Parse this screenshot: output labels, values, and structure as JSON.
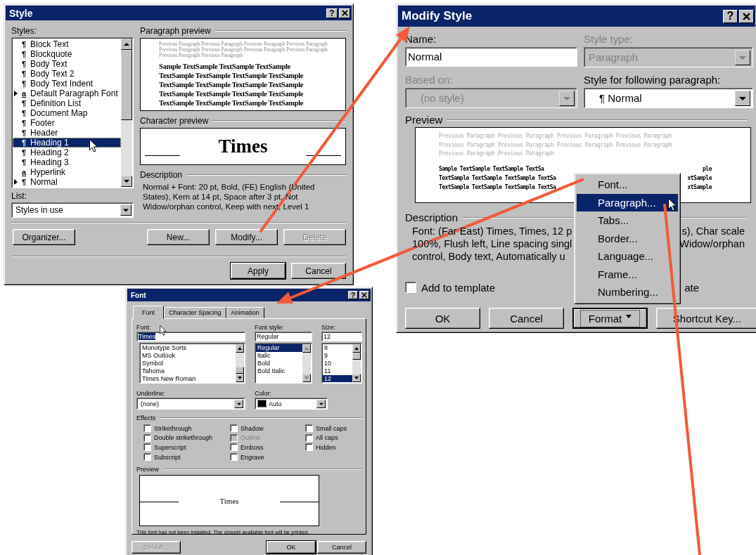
{
  "style_dialog": {
    "title": "Style",
    "help_button": "?",
    "styles_label": "Styles:",
    "styles": [
      {
        "symbol": "¶",
        "kind": "paragraph",
        "label": "Block Text",
        "has_arrow": false,
        "selected": false
      },
      {
        "symbol": "¶",
        "kind": "paragraph",
        "label": "Blockquote",
        "has_arrow": false,
        "selected": false
      },
      {
        "symbol": "¶",
        "kind": "paragraph",
        "label": "Body Text",
        "has_arrow": false,
        "selected": false
      },
      {
        "symbol": "¶",
        "kind": "paragraph",
        "label": "Body Text 2",
        "has_arrow": false,
        "selected": false
      },
      {
        "symbol": "¶",
        "kind": "paragraph",
        "label": "Body Text Indent",
        "has_arrow": false,
        "selected": false
      },
      {
        "symbol": "a",
        "kind": "character",
        "label": "Default Paragraph Font",
        "has_arrow": true,
        "selected": false
      },
      {
        "symbol": "¶",
        "kind": "paragraph",
        "label": "Definition List",
        "has_arrow": false,
        "selected": false
      },
      {
        "symbol": "¶",
        "kind": "paragraph",
        "label": "Document Map",
        "has_arrow": false,
        "selected": false
      },
      {
        "symbol": "¶",
        "kind": "paragraph",
        "label": "Footer",
        "has_arrow": false,
        "selected": false
      },
      {
        "symbol": "¶",
        "kind": "paragraph",
        "label": "Header",
        "has_arrow": false,
        "selected": false
      },
      {
        "symbol": "¶",
        "kind": "paragraph",
        "label": "Heading 1",
        "has_arrow": false,
        "selected": true
      },
      {
        "symbol": "¶",
        "kind": "paragraph",
        "label": "Heading 2",
        "has_arrow": false,
        "selected": false
      },
      {
        "symbol": "¶",
        "kind": "paragraph",
        "label": "Heading 3",
        "has_arrow": false,
        "selected": false
      },
      {
        "symbol": "a",
        "kind": "character",
        "label": "Hyperlink",
        "has_arrow": false,
        "selected": false
      },
      {
        "symbol": "¶",
        "kind": "paragraph",
        "label": "Normal",
        "has_arrow": true,
        "selected": false
      }
    ],
    "list_label": "List:",
    "list_value": "Styles in use",
    "paragraph_preview": {
      "label": "Paragraph preview",
      "previous_lines": [
        "Previous Paragraph Previous Paragraph Previous Paragraph Previous Paragraph",
        "Previous Paragraph Previous Paragraph Previous Paragraph Previous Paragraph",
        "Previous Paragraph Previous Paragraph"
      ],
      "sample_lines": [
        "Sample TextSample TextSample TextSample",
        "TextSample TextSample TextSample TextSample",
        "TextSample TextSample TextSample TextSample",
        "TextSample TextSample TextSample TextSample",
        "TextSample TextSample TextSample TextSample"
      ]
    },
    "character_preview": {
      "label": "Character preview",
      "text": "Times"
    },
    "description": {
      "label": "Description",
      "text": "Normal + Font: 20 pt, Bold, (FE) English (United States), Kern at 14 pt, Space  after 3 pt, Not Widow/orphan control, Keep with next, Level 1"
    },
    "manage_buttons": [
      {
        "label": "Organizer...",
        "disabled": false,
        "default": false
      },
      {
        "label": "New...",
        "disabled": false,
        "default": false
      },
      {
        "label": "Modify...",
        "disabled": false,
        "default": false
      },
      {
        "label": "Delete",
        "disabled": true,
        "default": false
      }
    ],
    "action_buttons": [
      {
        "label": "Apply",
        "disabled": false,
        "default": true
      },
      {
        "label": "Cancel",
        "disabled": false,
        "default": false
      }
    ]
  },
  "modify_style_dialog": {
    "title": "Modify Style",
    "help_button": "?",
    "name": {
      "label": "Name:",
      "value": "Normal"
    },
    "style_type": {
      "label": "Style type:",
      "value": "Paragraph",
      "disabled": true
    },
    "based_on": {
      "label": "Based on:",
      "value": "(no style)",
      "disabled": true
    },
    "following": {
      "label": "Style for following paragraph:",
      "value": "¶ Normal",
      "disabled": false
    },
    "preview": {
      "label": "Preview",
      "previous_lines": [
        "Previous Paragraph Previous Paragraph Previous Paragraph Previous Paragraph",
        "Previous Paragraph Previous Paragraph Previous Paragraph Previous Paragraph",
        "Previous Paragraph Previous Paragraph"
      ],
      "sample_lines": [
        {
          "left": "Sample TextSample TextSample TextSa",
          "right": "ple"
        },
        {
          "left": "TextSample TextSample TextSample TextSa",
          "right": "xtSample"
        },
        {
          "left": "TextSample TextSample TextSample TextSa",
          "right": "xtSample"
        }
      ]
    },
    "description": {
      "label": "Description",
      "lines": [
        {
          "left": "Font: (Far East) Times, Times, 12 p",
          "right": "s), Char scale"
        },
        {
          "left": "100%, Flush left, Line spacing singl",
          "right": "Widow/orphan"
        },
        {
          "left": "control, Body text, Automatically u"
        }
      ]
    },
    "add_to_template": {
      "label": "Add to template",
      "checked": false
    },
    "hidden_option_fragment": "ate",
    "buttons": [
      {
        "label": "OK",
        "kind": "push",
        "focused": false
      },
      {
        "label": "Cancel",
        "kind": "push",
        "focused": false
      },
      {
        "label": "Format",
        "kind": "menu",
        "focused": true
      },
      {
        "label": "Shortcut Key...",
        "kind": "push",
        "focused": false
      }
    ],
    "format_menu": [
      {
        "label": "Font...",
        "selected": false
      },
      {
        "label": "Paragraph...",
        "selected": true
      },
      {
        "label": "Tabs...",
        "selected": false
      },
      {
        "label": "Border...",
        "selected": false
      },
      {
        "label": "Language...",
        "selected": false
      },
      {
        "label": "Frame...",
        "selected": false
      },
      {
        "label": "Numbering...",
        "selected": false
      }
    ]
  },
  "font_dialog": {
    "title": "Font",
    "help_button": "?",
    "tabs": [
      {
        "label": "Font",
        "selected": true
      },
      {
        "label": "Character Spacing",
        "selected": false
      },
      {
        "label": "Animation",
        "selected": false
      }
    ],
    "font": {
      "label": "Font:",
      "value": "Times",
      "value_highlighted": true,
      "options": [
        {
          "label": "Monotype Sorts",
          "selected": false
        },
        {
          "label": "MS Outlook",
          "selected": false
        },
        {
          "label": "Symbol",
          "selected": false
        },
        {
          "label": "Tahoma",
          "selected": false
        },
        {
          "label": "Times New Roman",
          "selected": false
        }
      ]
    },
    "font_style": {
      "label": "Font style:",
      "value": "Regular",
      "options": [
        {
          "label": "Regular",
          "selected": true
        },
        {
          "label": "Italic",
          "selected": false
        },
        {
          "label": "Bold",
          "selected": false
        },
        {
          "label": "Bold Italic",
          "selected": false
        }
      ]
    },
    "size": {
      "label": "Size:",
      "value": "12",
      "options": [
        {
          "label": "8",
          "selected": false
        },
        {
          "label": "9",
          "selected": false
        },
        {
          "label": "10",
          "selected": false
        },
        {
          "label": "11",
          "selected": false
        },
        {
          "label": "12",
          "selected": true
        }
      ]
    },
    "underline": {
      "label": "Underline:",
      "value": "(none)"
    },
    "color": {
      "label": "Color:",
      "value": "Auto",
      "color": "#000000"
    },
    "effects": {
      "label": "Effects",
      "columns": [
        [
          {
            "label": "Strikethrough",
            "checked": false,
            "disabled": false
          },
          {
            "label": "Double strikethrough",
            "checked": false,
            "disabled": false
          },
          {
            "label": "Superscript",
            "checked": false,
            "disabled": false
          },
          {
            "label": "Subscript",
            "checked": false,
            "disabled": false
          }
        ],
        [
          {
            "label": "Shadow",
            "checked": false,
            "disabled": false
          },
          {
            "label": "Outline",
            "checked": false,
            "disabled": true
          },
          {
            "label": "Emboss",
            "checked": false,
            "disabled": false
          },
          {
            "label": "Engrave",
            "checked": false,
            "disabled": false
          }
        ],
        [
          {
            "label": "Small caps",
            "checked": false,
            "disabled": false
          },
          {
            "label": "All caps",
            "checked": false,
            "disabled": false
          },
          {
            "label": "Hidden",
            "checked": false,
            "disabled": false
          }
        ]
      ]
    },
    "preview": {
      "label": "Preview",
      "text": "Times"
    },
    "note": "This font has not been installed. The closest available font will be printed.",
    "buttons": [
      {
        "label": "Default...",
        "disabled": true,
        "default": false
      },
      {
        "label": "OK",
        "disabled": false,
        "default": true
      },
      {
        "label": "Cancel",
        "disabled": false,
        "default": false
      }
    ]
  }
}
